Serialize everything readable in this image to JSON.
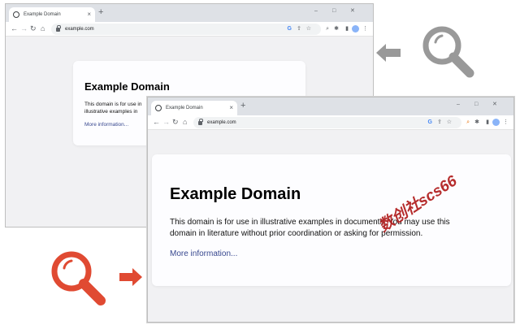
{
  "browser": {
    "tab_title": "Example Domain",
    "tab_close": "×",
    "new_tab": "+",
    "window_controls": {
      "minimize": "–",
      "maximize": "□",
      "close": "✕"
    },
    "nav": {
      "back": "←",
      "forward": "→",
      "reload": "↻",
      "home": "⌂"
    },
    "url": "example.com",
    "toolbar_icons": {
      "google": "G",
      "share": "⇪",
      "bookmark": "☆",
      "zoom": "⌕",
      "extensions": "✱",
      "sidepanel": "▮",
      "menu": "⋮"
    }
  },
  "page": {
    "title": "Example Domain",
    "body_text": "This domain is for use in illustrative examples in documents. You may use this domain in literature without prior coordination or asking for permission.",
    "link_text": "More information..."
  },
  "watermark": "数创社scs66",
  "colors": {
    "gray_icon": "#999999",
    "red_icon": "#e04a32",
    "accent_link": "#38488f",
    "watermark": "#b01c1c"
  },
  "icons": {
    "top_magnifier": "magnifier-icon",
    "top_arrow": "arrow-left-icon",
    "bottom_magnifier": "magnifier-icon",
    "bottom_arrow": "arrow-right-icon"
  }
}
